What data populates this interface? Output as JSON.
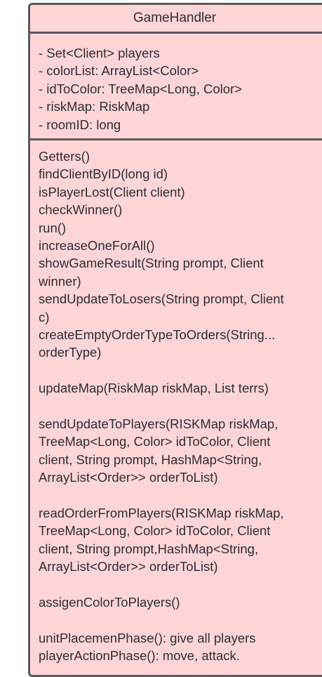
{
  "class_name": "GameHandler",
  "attributes": [
    "- Set<Client> players",
    "- colorList: ArrayList<Color>",
    "- idToColor: TreeMap<Long, Color>",
    "- riskMap: RiskMap",
    "- roomID: long"
  ],
  "methods": [
    "Getters()",
    "findClientByID(long id)",
    "isPlayerLost(Client client)",
    "checkWinner()",
    "run()",
    "increaseOneForAll()",
    "showGameResult(String prompt, Client",
    "winner)",
    "sendUpdateToLosers(String prompt, Client",
    "c)",
    "createEmptyOrderTypeToOrders(String...",
    "orderType)",
    "",
    "updateMap(RiskMap riskMap, List terrs)",
    "",
    "sendUpdateToPlayers(RISKMap riskMap,",
    "TreeMap<Long, Color> idToColor, Client",
    "client, String prompt, HashMap<String,",
    "ArrayList<Order>> orderToList)",
    "",
    "readOrderFromPlayers(RISKMap riskMap,",
    "TreeMap<Long, Color> idToColor, Client",
    "client, String prompt,HashMap<String,",
    "ArrayList<Order>> orderToList)",
    "",
    "assigenColorToPlayers()",
    "",
    "unitPlacemenPhase(): give all players",
    "playerActionPhase(): move, attack."
  ],
  "colors": {
    "fill": "#ffd5d8",
    "border": "#5a5a5a",
    "text": "#2f2f2f"
  }
}
